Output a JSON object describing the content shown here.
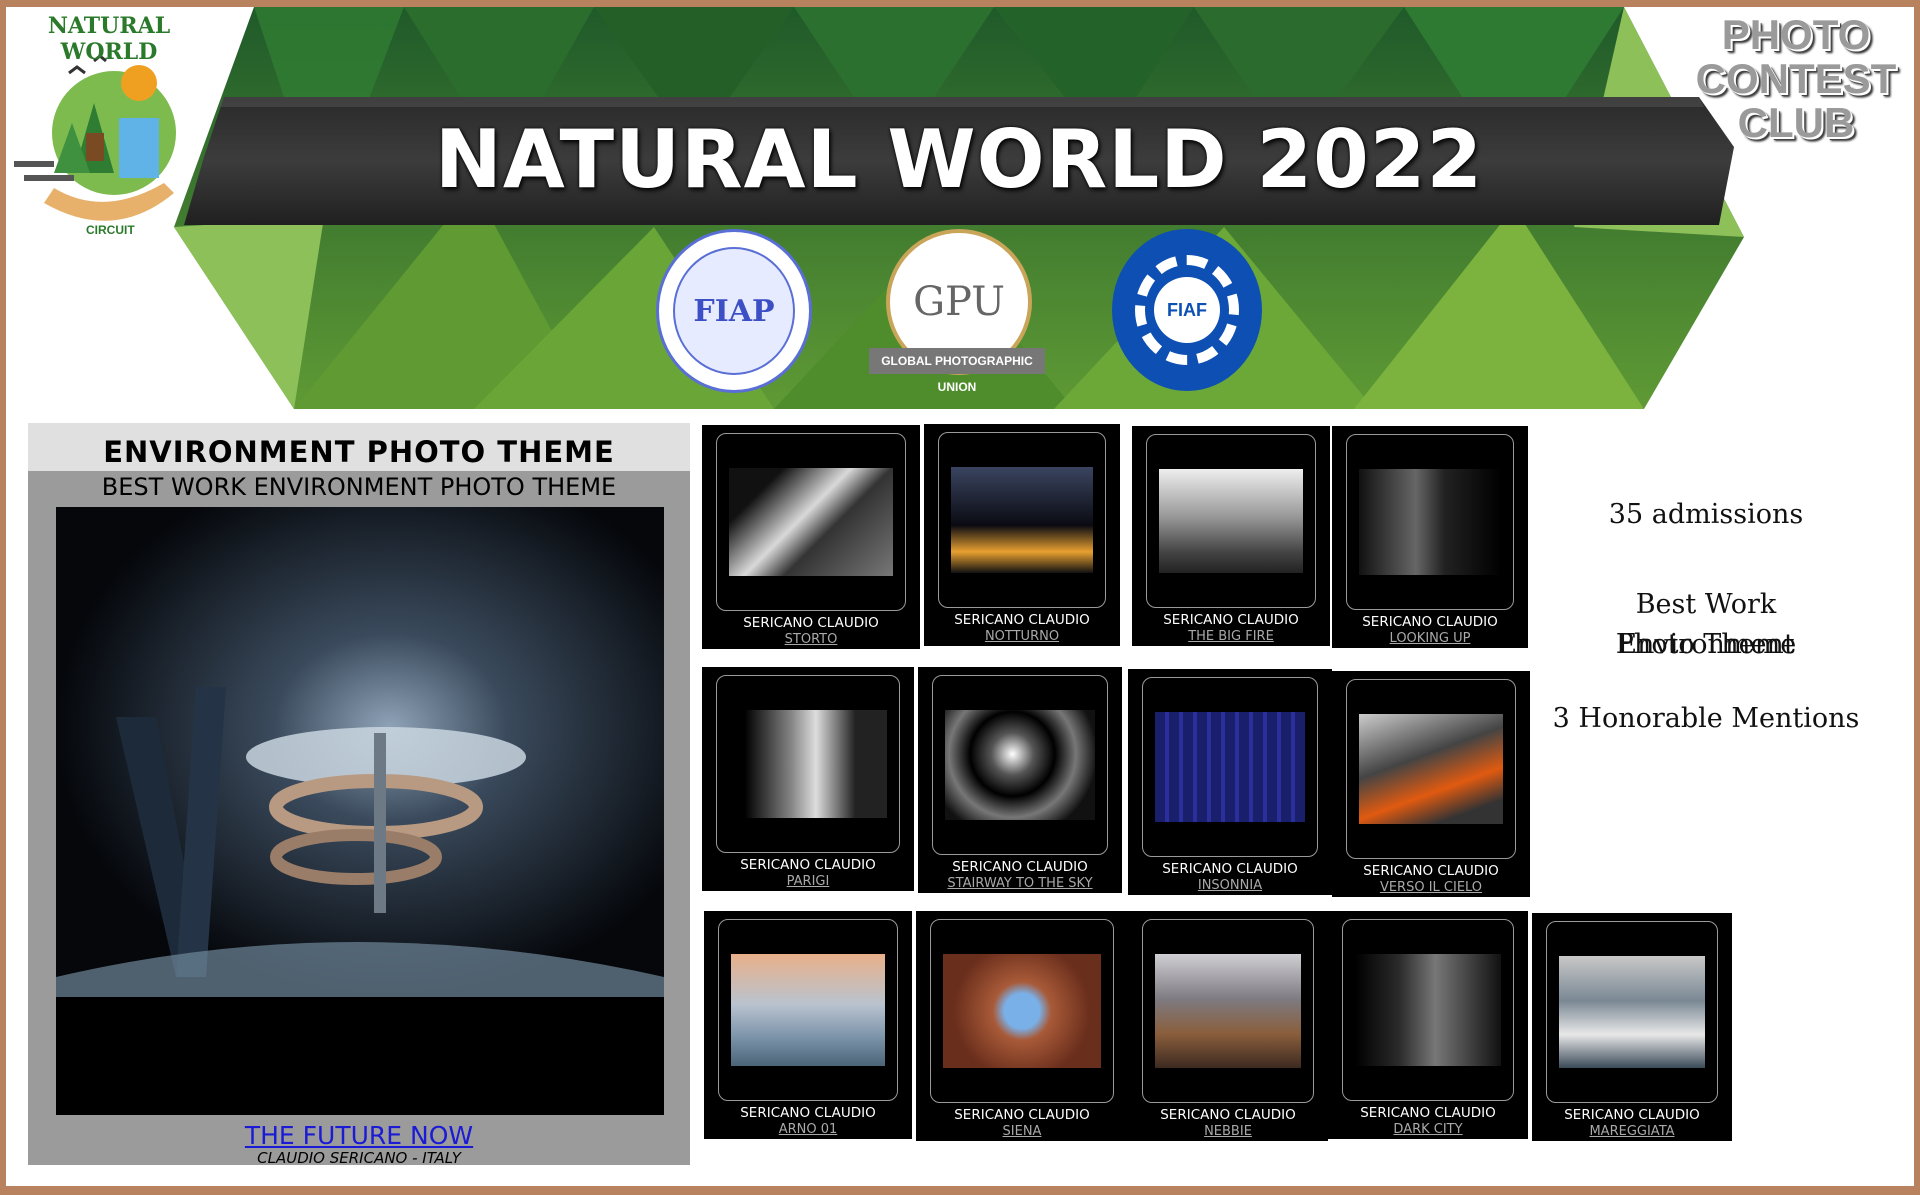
{
  "banner": {
    "title": "NATURAL WORLD 2022",
    "seals": {
      "fiap": "FIAP",
      "gpu": "GPU",
      "gpu_caption": "GLOBAL PHOTOGRAPHIC UNION",
      "fiaf": "FIAF"
    }
  },
  "logos": {
    "left_arc_text": "NATURAL WORLD",
    "left_circuit": "CIRCUIT",
    "right_line1": "PHOTO",
    "right_line2": "CONTEST",
    "right_line3": "CLUB"
  },
  "featured": {
    "heading": "ENVIRONMENT PHOTO THEME",
    "award": "BEST WORK ENVIRONMENT PHOTO THEME",
    "photo_title": "THE FUTURE NOW",
    "author": "CLAUDIO SERICANO - ITALY"
  },
  "thumbnails": [
    {
      "author": "SERICANO CLAUDIO",
      "title": "STORTO"
    },
    {
      "author": "SERICANO CLAUDIO",
      "title": "NOTTURNO"
    },
    {
      "author": "SERICANO CLAUDIO",
      "title": "THE BIG FIRE"
    },
    {
      "author": "SERICANO CLAUDIO",
      "title": "LOOKING UP"
    },
    {
      "author": "SERICANO CLAUDIO",
      "title": "PARIGI"
    },
    {
      "author": "SERICANO CLAUDIO",
      "title": "STAIRWAY TO THE SKY"
    },
    {
      "author": "SERICANO CLAUDIO",
      "title": "INSONNIA"
    },
    {
      "author": "SERICANO CLAUDIO",
      "title": "VERSO IL CIELO"
    },
    {
      "author": "SERICANO CLAUDIO",
      "title": "ARNO 01"
    },
    {
      "author": "SERICANO CLAUDIO",
      "title": "SIENA"
    },
    {
      "author": "SERICANO CLAUDIO",
      "title": "NEBBIE"
    },
    {
      "author": "SERICANO CLAUDIO",
      "title": "DARK CITY"
    },
    {
      "author": "SERICANO CLAUDIO",
      "title": "MAREGGIATA"
    }
  ],
  "stats": {
    "admissions": "35 admissions",
    "best_work_line1": "Best Work Environment",
    "best_work_line2": "Photo Theme",
    "mentions": "3 Honorable Mentions"
  },
  "colors": {
    "frame": "#b9825e",
    "banner_green_dark": "#1f5a2a",
    "banner_green_light": "#7fb03f",
    "ribbon": "#333333",
    "link": "#1b1bd6"
  }
}
